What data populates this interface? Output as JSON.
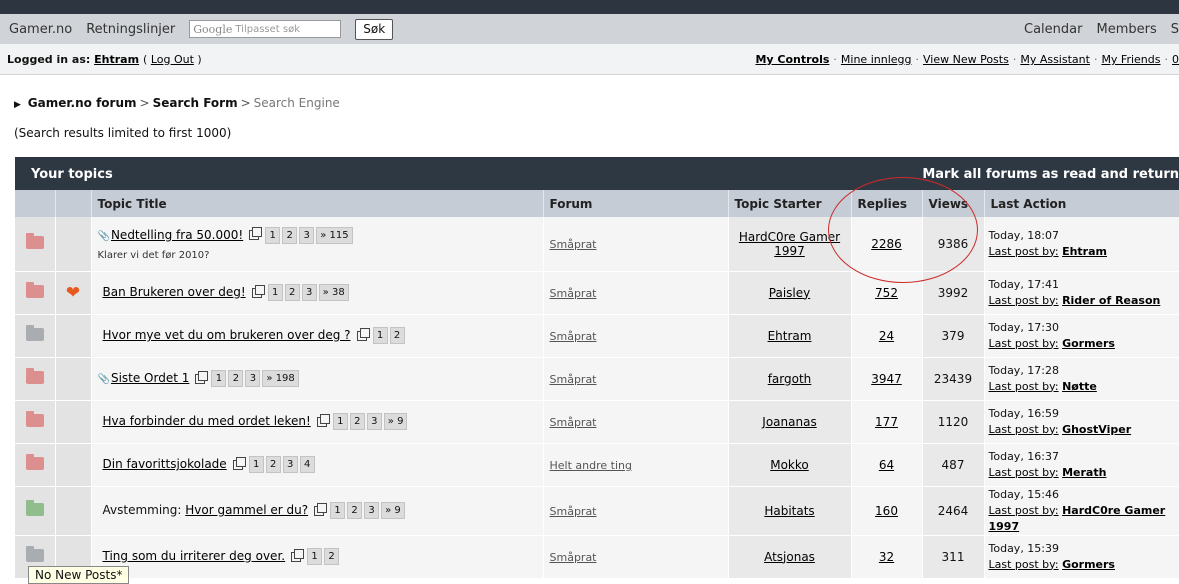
{
  "nav": {
    "left": [
      "Gamer.no",
      "Retningslinjer"
    ],
    "search_logo": "Google",
    "search_placeholder": "Tilpasset søk",
    "search_button": "Søk",
    "right": [
      "Calendar",
      "Members",
      "S"
    ]
  },
  "user": {
    "logged_in_label": "Logged in as:",
    "username": "Ehtram",
    "logout": "Log Out",
    "links": [
      "My Controls",
      "Mine innlegg",
      "View New Posts",
      "My Assistant",
      "My Friends",
      "0"
    ]
  },
  "breadcrumb": [
    "Gamer.no forum",
    "Search Form",
    "Search Engine"
  ],
  "limit_note": "(Search results limited to first 1000)",
  "panel": {
    "title": "Your topics",
    "mark_read": "Mark all forums as read and return"
  },
  "columns": [
    "Topic Title",
    "Forum",
    "Topic Starter",
    "Replies",
    "Views",
    "Last Action"
  ],
  "last_post_label": "Last post by:",
  "colors": {
    "folder_red": "#dd8f8f",
    "folder_grey": "#a9acb0",
    "folder_green": "#8fbd8b",
    "heart": "#e8591e",
    "annotation_circle": "#cc2b2b"
  },
  "topics": [
    {
      "folder": "red",
      "heart": false,
      "pinned": true,
      "prefix": "",
      "title": "Nedtelling fra 50.000!",
      "pages": [
        "1",
        "2",
        "3",
        "» 115"
      ],
      "subtitle": "Klarer vi det før 2010?",
      "forum": "Småprat",
      "starter": "HardC0re Gamer 1997",
      "replies": "2286",
      "views": "9386",
      "time": "Today, 18:07",
      "last_by": "Ehtram"
    },
    {
      "folder": "red",
      "heart": true,
      "pinned": false,
      "prefix": "",
      "title": "Ban Brukeren over deg!",
      "pages": [
        "1",
        "2",
        "3",
        "» 38"
      ],
      "subtitle": "",
      "forum": "Småprat",
      "starter": "Paisley",
      "replies": "752",
      "views": "3992",
      "time": "Today, 17:41",
      "last_by": "Rider of Reason"
    },
    {
      "folder": "grey",
      "heart": false,
      "pinned": false,
      "prefix": "",
      "title": "Hvor mye vet du om brukeren over deg ?",
      "pages": [
        "1",
        "2"
      ],
      "subtitle": "",
      "forum": "Småprat",
      "starter": "Ehtram",
      "replies": "24",
      "views": "379",
      "time": "Today, 17:30",
      "last_by": "Gormers"
    },
    {
      "folder": "red",
      "heart": false,
      "pinned": true,
      "prefix": "",
      "title": "Siste Ordet 1",
      "pages": [
        "1",
        "2",
        "3",
        "» 198"
      ],
      "subtitle": "",
      "forum": "Småprat",
      "starter": "fargoth",
      "replies": "3947",
      "views": "23439",
      "time": "Today, 17:28",
      "last_by": "Nøtte"
    },
    {
      "folder": "red",
      "heart": false,
      "pinned": false,
      "prefix": "",
      "title": "Hva forbinder du med ordet leken!",
      "pages": [
        "1",
        "2",
        "3",
        "» 9"
      ],
      "subtitle": "",
      "forum": "Småprat",
      "starter": "Joananas",
      "replies": "177",
      "views": "1120",
      "time": "Today, 16:59",
      "last_by": "GhostViper"
    },
    {
      "folder": "red",
      "heart": false,
      "pinned": false,
      "prefix": "",
      "title": "Din favorittsjokolade",
      "pages": [
        "1",
        "2",
        "3",
        "4"
      ],
      "subtitle": "",
      "forum": "Helt andre ting",
      "starter": "Mokko",
      "replies": "64",
      "views": "487",
      "time": "Today, 16:37",
      "last_by": "Merath"
    },
    {
      "folder": "green",
      "heart": false,
      "pinned": false,
      "prefix": "Avstemming:",
      "title": "Hvor gammel er du?",
      "pages": [
        "1",
        "2",
        "3",
        "» 9"
      ],
      "subtitle": "",
      "forum": "Småprat",
      "starter": "Habitats",
      "replies": "160",
      "views": "2464",
      "time": "Today, 15:46",
      "last_by": "HardC0re Gamer 1997"
    },
    {
      "folder": "grey",
      "heart": false,
      "pinned": false,
      "prefix": "",
      "title": "Ting som du irriterer deg over.",
      "pages": [
        "1",
        "2"
      ],
      "subtitle": "",
      "forum": "Småprat",
      "starter": "Atsjonas",
      "replies": "32",
      "views": "311",
      "time": "Today, 15:39",
      "last_by": "Gormers"
    }
  ],
  "tooltip": "No New Posts*"
}
